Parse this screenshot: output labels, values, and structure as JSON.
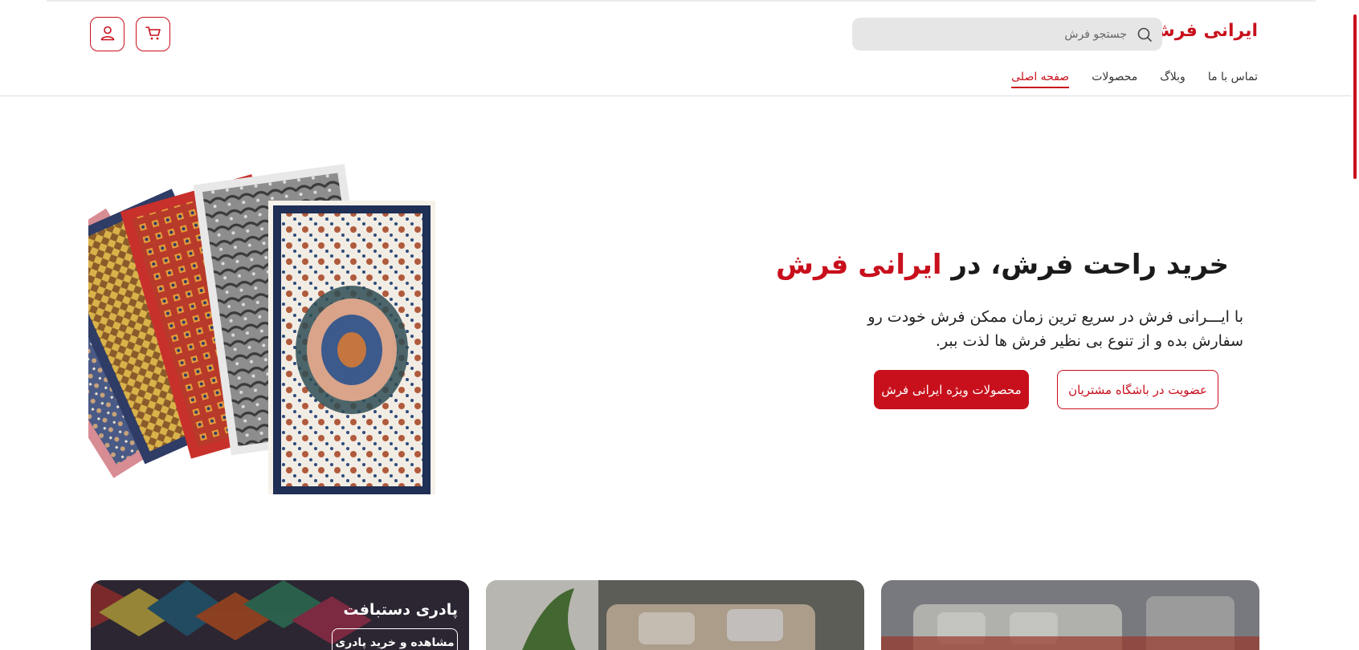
{
  "header": {
    "logo": "ایرانی فرش",
    "search": {
      "placeholder": "جستجو فرش",
      "value": ""
    },
    "cart_icon": "cart-icon",
    "user_icon": "user-icon"
  },
  "nav": {
    "items": [
      {
        "label": "صفحه اصلی",
        "active": true
      },
      {
        "label": "محصولات",
        "active": false
      },
      {
        "label": "وبلاگ",
        "active": false
      },
      {
        "label": "تماس با ما",
        "active": false
      }
    ]
  },
  "hero": {
    "title_part1": "خرید راحت فرش، در ",
    "title_accent": "ایرانی فرش",
    "subtitle": "با ایـــرانی فرش در سریع ترین زمان ممکن فرش خودت رو سفارش بده و از تنوع بی نظیر فرش ها لذت ببر.",
    "btn_outline": "عضویت در باشگاه مشتریان",
    "btn_solid": "محصولات ویژه ایرانی فرش"
  },
  "cards": [
    {
      "title": "پادری دستبافت",
      "button": "مشاهده و خرید پادری"
    },
    {
      "title": "",
      "button": ""
    },
    {
      "title": "",
      "button": ""
    }
  ],
  "colors": {
    "accent": "#c8101c",
    "search_bg": "#e6e6e6",
    "border": "#dedede"
  }
}
